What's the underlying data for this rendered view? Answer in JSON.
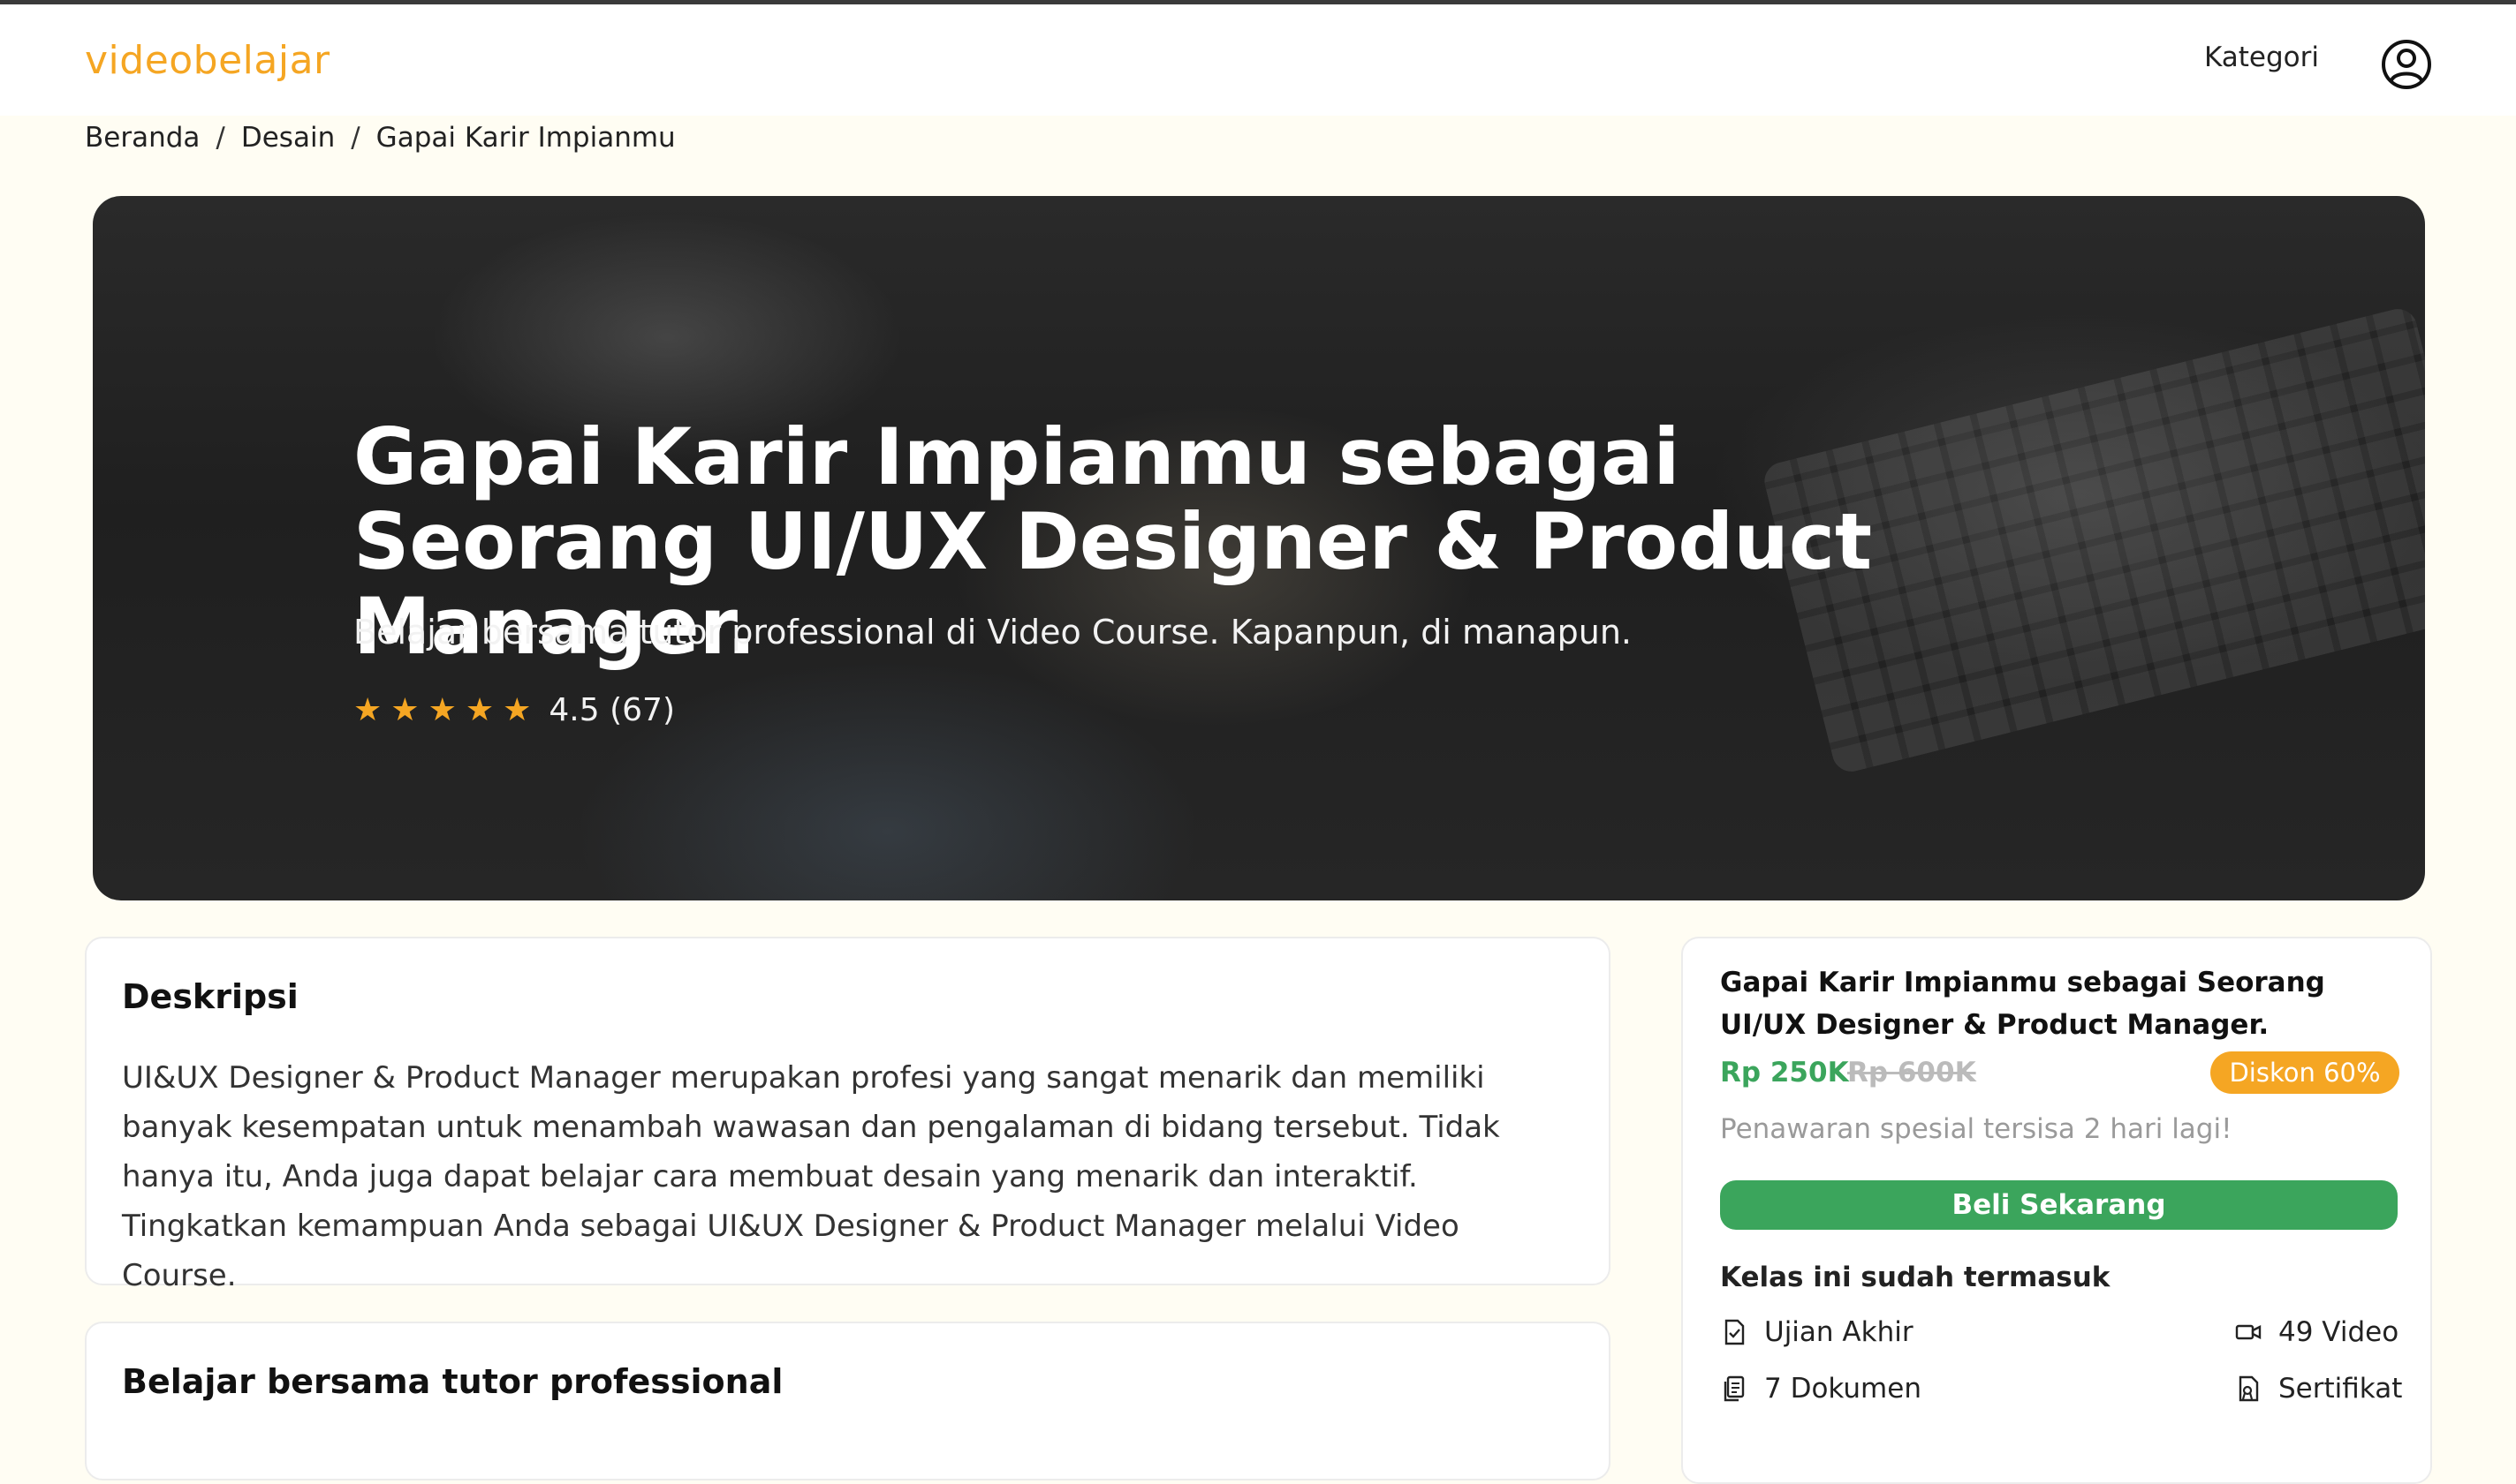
{
  "brand": {
    "logo": "videobelajar",
    "accent": "#f5a623"
  },
  "nav": {
    "kategori": "Kategori",
    "avatar_icon": "user-circle-icon"
  },
  "breadcrumb": {
    "items": [
      "Beranda",
      "Desain",
      "Gapai Karir Impianmu"
    ],
    "separator": "/"
  },
  "hero": {
    "title": "Gapai Karir Impianmu sebagai Seorang UI/UX Designer & Product Manager.",
    "subtitle": "Belajar bersama tutor professional di Video Course. Kapanpun, di manapun.",
    "rating": {
      "value": 4.5,
      "stars": 5,
      "text": "4.5 (67)"
    }
  },
  "description": {
    "title": "Deskripsi",
    "body": "UI&UX Designer & Product Manager merupakan profesi yang sangat menarik dan memiliki banyak kesempatan untuk menambah wawasan dan pengalaman di bidang tersebut. Tidak hanya itu, Anda juga dapat belajar cara membuat desain yang menarik dan interaktif. Tingkatkan kemampuan Anda sebagai UI&UX Designer & Product Manager melalui Video Course."
  },
  "tutor": {
    "title": "Belajar bersama tutor professional"
  },
  "sidebar": {
    "title": "Gapai Karir Impianmu sebagai Seorang UI/UX Designer & Product Manager.",
    "price_now": "Rp 250K",
    "price_old": "Rp 600K",
    "discount": "Diskon 60%",
    "offer": "Penawaran spesial tersisa 2 hari lagi!",
    "buy_label": "Beli Sekarang",
    "includes_title": "Kelas ini sudah termasuk",
    "includes": [
      {
        "label": "Ujian Akhir",
        "icon": "file-check-icon"
      },
      {
        "label": "49 Video",
        "icon": "video-icon"
      },
      {
        "label": "7 Dokumen",
        "icon": "documents-icon"
      },
      {
        "label": "Sertifikat",
        "icon": "certificate-icon"
      }
    ],
    "colors": {
      "price": "#3ba55c",
      "button": "#3ba55c",
      "badge": "#f5a623"
    }
  }
}
